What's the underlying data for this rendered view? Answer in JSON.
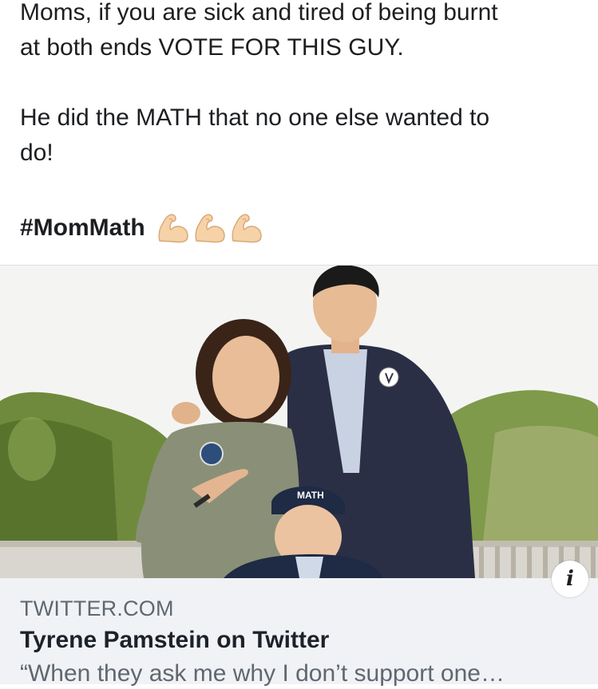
{
  "post": {
    "line1": "Moms, if you are sick and tired of being burnt",
    "line2": "at both ends VOTE FOR THIS GUY.",
    "line3": "He did the MATH that no one else wanted to",
    "line4": "do!",
    "hashtag": "#MomMath",
    "emojis": [
      "flexed-biceps-icon",
      "flexed-biceps-icon",
      "flexed-biceps-icon"
    ]
  },
  "link_card": {
    "image": {
      "cap_text": "MATH"
    },
    "domain": "TWITTER.COM",
    "title": "Tyrene Pamstein on Twitter",
    "description": "“When they ask me why I don’t support one…",
    "info_icon_glyph": "i"
  },
  "colors": {
    "text": "#1c1e21",
    "muted": "#606770",
    "card_bg": "#f0f2f5",
    "emoji_skin": "#f6d2a9"
  }
}
